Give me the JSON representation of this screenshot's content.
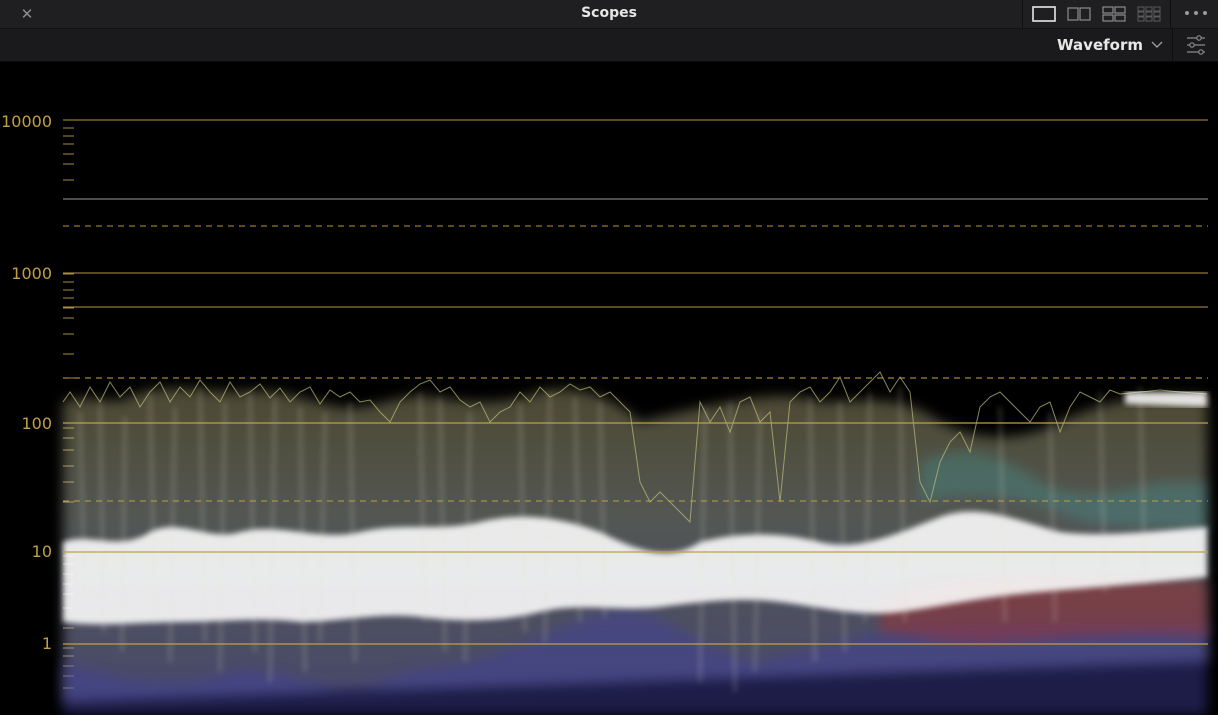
{
  "window": {
    "title": "Scopes"
  },
  "title_bar": {
    "close_glyph": "✕",
    "layout_buttons": [
      "single-layout-icon",
      "dual-layout-icon",
      "quad-layout-icon",
      "grid-layout-icon"
    ],
    "more_icon": "more-dots-icon"
  },
  "toolbar": {
    "scope_type": "Waveform",
    "dropdown_icon": "chevron-down-icon",
    "settings_icon": "sliders-icon"
  },
  "scope": {
    "scale": "log",
    "unit": "nits",
    "axis_labels": [
      "10000",
      "1000",
      "100",
      "10",
      "1"
    ],
    "guide_color": "#c0a044"
  }
}
